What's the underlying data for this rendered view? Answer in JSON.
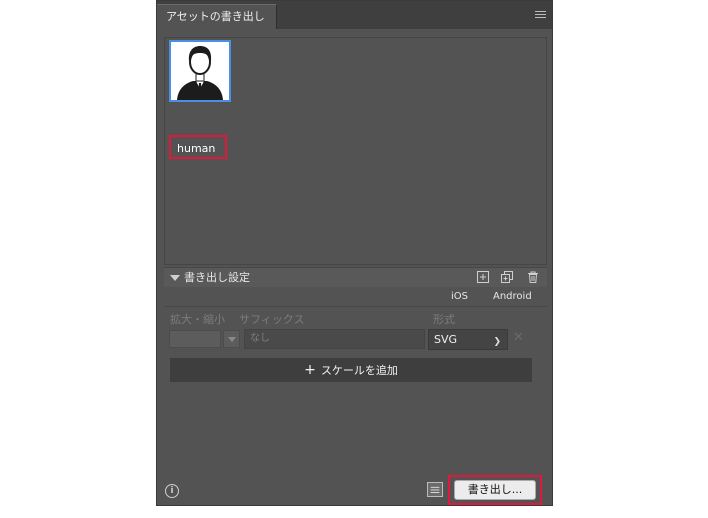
{
  "panel": {
    "tab_title": "アセットの書き出し"
  },
  "assets": [
    {
      "label": "human"
    }
  ],
  "export_settings": {
    "title": "書き出し設定",
    "presets": [
      "iOS",
      "Android"
    ],
    "columns": {
      "scale": "拡大・縮小",
      "suffix": "サフィックス",
      "format": "形式"
    },
    "row": {
      "suffix_placeholder": "なし",
      "format": "SVG"
    },
    "add_scale_label": "スケールを追加"
  },
  "footer": {
    "export_label": "書き出し..."
  },
  "icons": [
    "panel-menu-icon",
    "user-icon",
    "add-icon",
    "duplicate-icon",
    "trash-icon",
    "info-icon",
    "list-icon",
    "close-icon",
    "chevron-down-icon",
    "plus-icon"
  ],
  "colors": {
    "panel_bg": "#535353",
    "selection": "#4b8ee6",
    "highlight": "#e0183c"
  }
}
